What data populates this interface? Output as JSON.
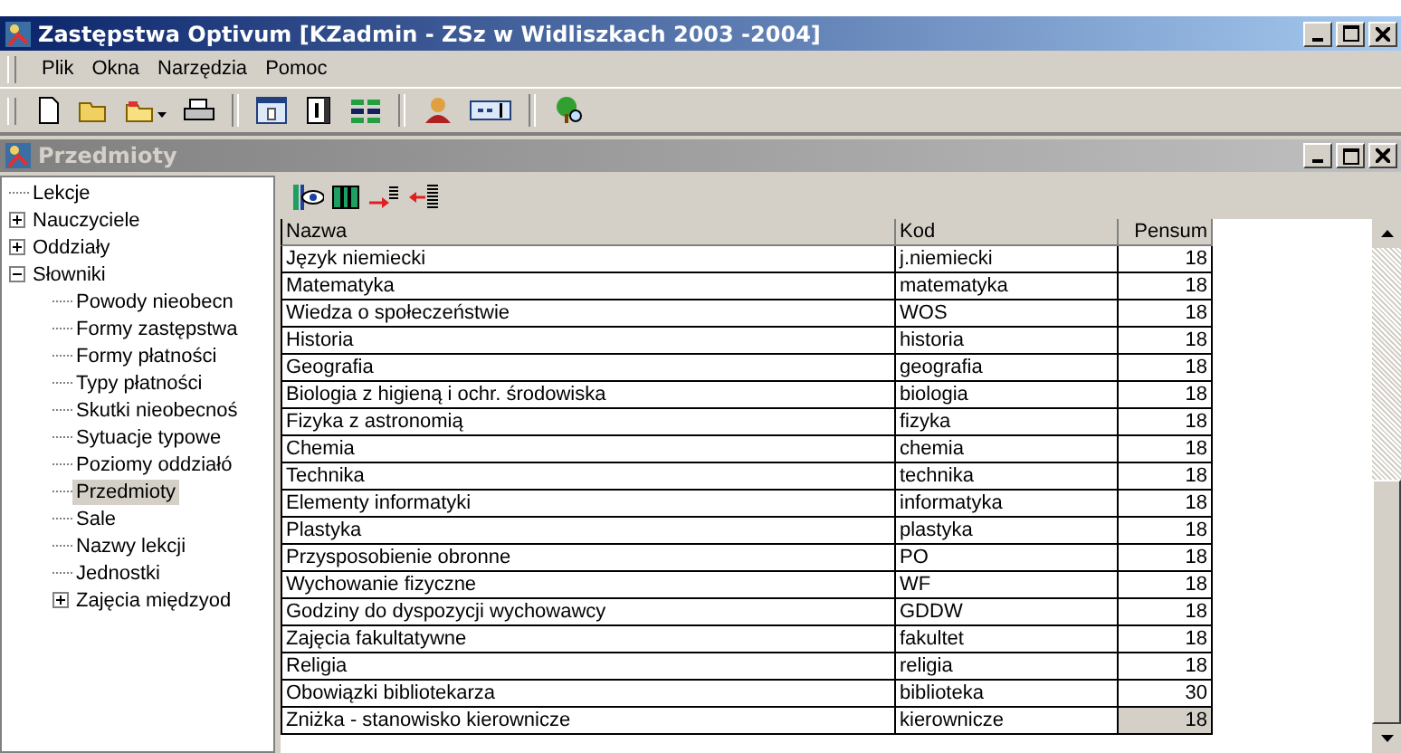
{
  "window": {
    "title": "Zastępstwa Optivum [KZadmin - ZSz w Widliszkach 2003 -2004]"
  },
  "menu": [
    "Plik",
    "Okna",
    "Narzędzia",
    "Pomoc"
  ],
  "child_window": {
    "title": "Przedmioty",
    "active": false
  },
  "tree": [
    {
      "label": "Lekcje",
      "selected": false
    },
    {
      "label": "Nauczyciele",
      "selected": false,
      "expanded": false
    },
    {
      "label": "Oddziały",
      "selected": false,
      "expanded": false
    },
    {
      "label": "Słowniki",
      "selected": false,
      "expanded": true,
      "children": [
        {
          "label": "Powody nieobecn",
          "selected": false
        },
        {
          "label": "Formy zastępstwa",
          "selected": false
        },
        {
          "label": "Formy płatności",
          "selected": false
        },
        {
          "label": "Typy płatności",
          "selected": false
        },
        {
          "label": "Skutki nieobecnoś",
          "selected": false
        },
        {
          "label": "Sytuacje typowe",
          "selected": false
        },
        {
          "label": "Poziomy oddziałó",
          "selected": false
        },
        {
          "label": "Przedmioty",
          "selected": true
        },
        {
          "label": "Sale",
          "selected": false
        },
        {
          "label": "Nazwy lekcji",
          "selected": false
        },
        {
          "label": "Jednostki",
          "selected": false
        },
        {
          "label": "Zajęcia międzyod",
          "selected": false,
          "expanded": false
        }
      ]
    }
  ],
  "table": {
    "columns": [
      "Nazwa",
      "Kod",
      "Pensum"
    ],
    "rows": [
      {
        "nazwa": "Język niemiecki",
        "kod": "j.niemiecki",
        "pensum": "18",
        "selected": false
      },
      {
        "nazwa": "Matematyka",
        "kod": "matematyka",
        "pensum": "18",
        "selected": false
      },
      {
        "nazwa": "Wiedza o społeczeństwie",
        "kod": "WOS",
        "pensum": "18",
        "selected": false
      },
      {
        "nazwa": "Historia",
        "kod": "historia",
        "pensum": "18",
        "selected": false
      },
      {
        "nazwa": "Geografia",
        "kod": "geografia",
        "pensum": "18",
        "selected": false
      },
      {
        "nazwa": "Biologia z higieną i ochr. środowiska",
        "kod": "biologia",
        "pensum": "18",
        "selected": false
      },
      {
        "nazwa": "Fizyka z astronomią",
        "kod": "fizyka",
        "pensum": "18",
        "selected": false
      },
      {
        "nazwa": "Chemia",
        "kod": "chemia",
        "pensum": "18",
        "selected": false
      },
      {
        "nazwa": "Technika",
        "kod": "technika",
        "pensum": "18",
        "selected": false
      },
      {
        "nazwa": "Elementy informatyki",
        "kod": "informatyka",
        "pensum": "18",
        "selected": false
      },
      {
        "nazwa": "Plastyka",
        "kod": "plastyka",
        "pensum": "18",
        "selected": false
      },
      {
        "nazwa": "Przysposobienie obronne",
        "kod": "PO",
        "pensum": "18",
        "selected": false
      },
      {
        "nazwa": "Wychowanie fizyczne",
        "kod": "WF",
        "pensum": "18",
        "selected": false
      },
      {
        "nazwa": "Godziny do dyspozycji wychowawcy",
        "kod": "GDDW",
        "pensum": "18",
        "selected": false
      },
      {
        "nazwa": "Zajęcia fakultatywne",
        "kod": "fakultet",
        "pensum": "18",
        "selected": false
      },
      {
        "nazwa": "Religia",
        "kod": "religia",
        "pensum": "18",
        "selected": false
      },
      {
        "nazwa": "Obowiązki bibliotekarza",
        "kod": "biblioteka",
        "pensum": "30",
        "selected": false
      },
      {
        "nazwa": "Zniżka - stanowisko kierownicze",
        "kod": "kierownicze",
        "pensum": "18",
        "selected": true
      }
    ]
  }
}
